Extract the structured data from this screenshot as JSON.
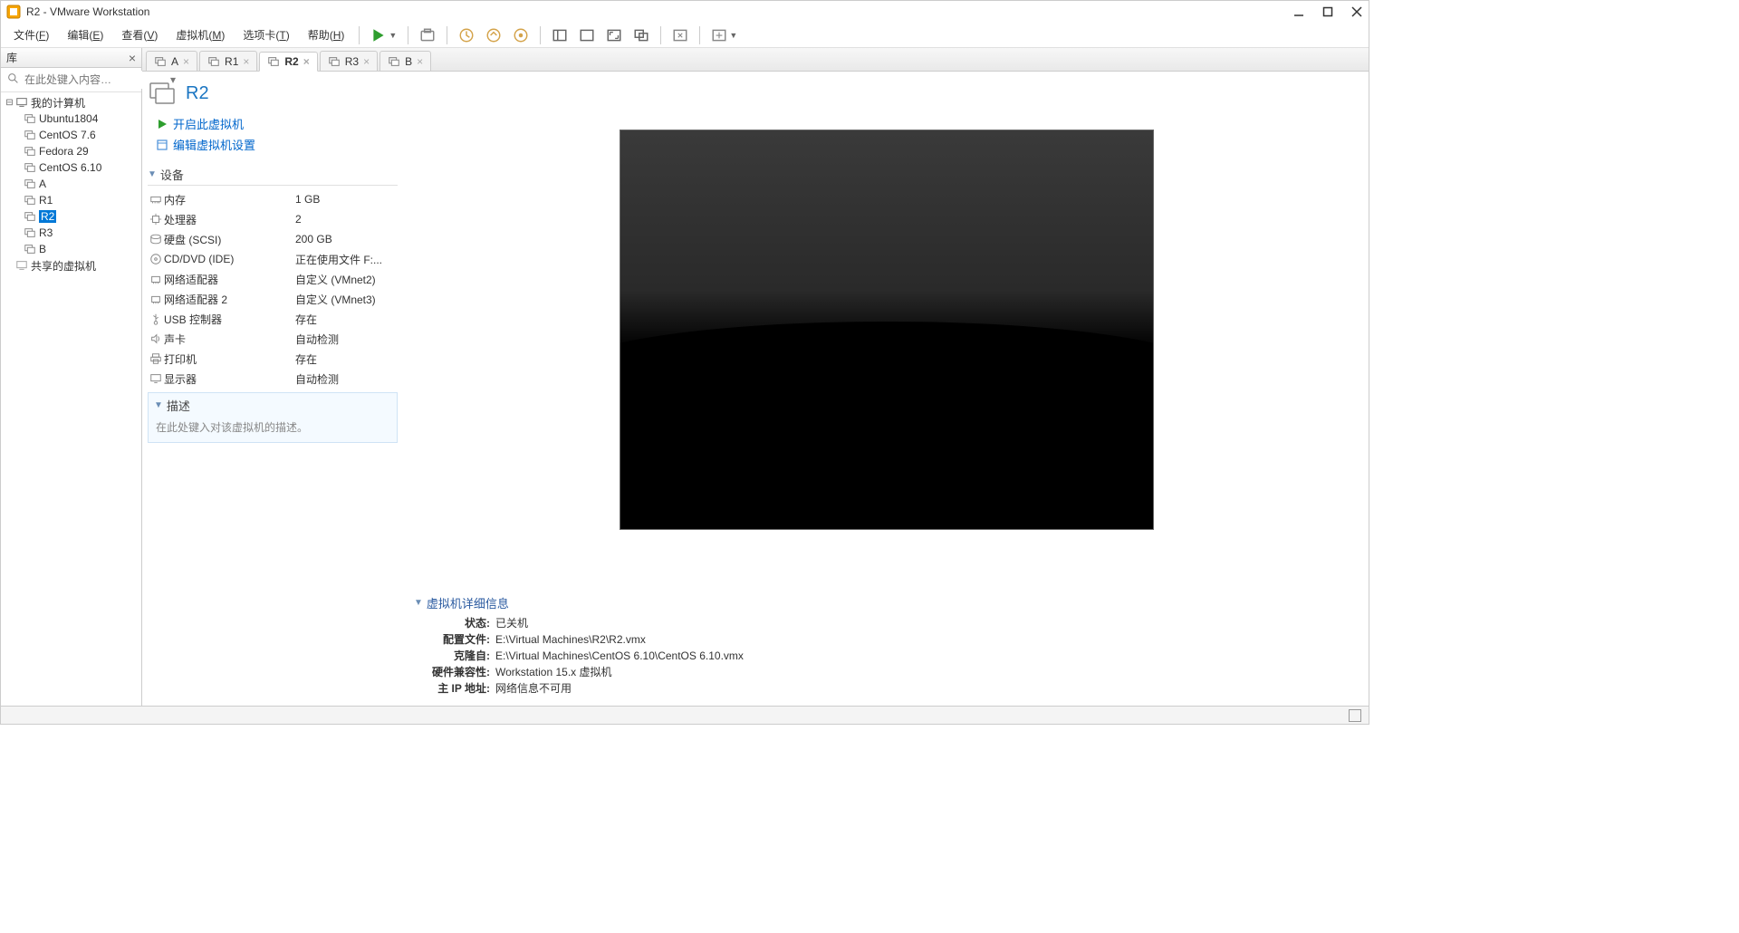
{
  "title": "R2 - VMware Workstation",
  "menus": {
    "file": "文件(F)",
    "edit": "编辑(E)",
    "view": "查看(V)",
    "vm": "虚拟机(M)",
    "tabs": "选项卡(T)",
    "help": "帮助(H)"
  },
  "sidebar": {
    "header": "库",
    "search_placeholder": "在此处键入内容…",
    "root": "我的计算机",
    "items": [
      {
        "label": "Ubuntu1804",
        "icon": "vm"
      },
      {
        "label": "CentOS 7.6",
        "icon": "vm"
      },
      {
        "label": "Fedora 29",
        "icon": "vm"
      },
      {
        "label": "CentOS 6.10",
        "icon": "vm"
      },
      {
        "label": "A",
        "icon": "vm"
      },
      {
        "label": "R1",
        "icon": "vm"
      },
      {
        "label": "R2",
        "icon": "vm",
        "selected": true
      },
      {
        "label": "R3",
        "icon": "vm"
      },
      {
        "label": "B",
        "icon": "vm"
      }
    ],
    "shared": "共享的虚拟机"
  },
  "tabs": [
    {
      "label": "A"
    },
    {
      "label": "R1"
    },
    {
      "label": "R2",
      "active": true
    },
    {
      "label": "R3"
    },
    {
      "label": "B"
    }
  ],
  "vm": {
    "name": "R2",
    "actions": {
      "power_on": "开启此虚拟机",
      "edit_settings": "编辑虚拟机设置"
    },
    "devices_header": "设备",
    "devices": [
      {
        "icon": "memory-icon",
        "name": "内存",
        "value": "1 GB"
      },
      {
        "icon": "cpu-icon",
        "name": "处理器",
        "value": "2"
      },
      {
        "icon": "disk-icon",
        "name": "硬盘 (SCSI)",
        "value": "200 GB"
      },
      {
        "icon": "cd-icon",
        "name": "CD/DVD (IDE)",
        "value": "正在使用文件 F:..."
      },
      {
        "icon": "nic-icon",
        "name": "网络适配器",
        "value": "自定义 (VMnet2)"
      },
      {
        "icon": "nic-icon",
        "name": "网络适配器 2",
        "value": "自定义 (VMnet3)"
      },
      {
        "icon": "usb-icon",
        "name": "USB 控制器",
        "value": "存在"
      },
      {
        "icon": "sound-icon",
        "name": "声卡",
        "value": "自动检测"
      },
      {
        "icon": "printer-icon",
        "name": "打印机",
        "value": "存在"
      },
      {
        "icon": "display-icon",
        "name": "显示器",
        "value": "自动检测"
      }
    ],
    "description_header": "描述",
    "description_placeholder": "在此处键入对该虚拟机的描述。"
  },
  "details": {
    "header": "虚拟机详细信息",
    "rows": [
      {
        "k": "状态:",
        "v": "已关机"
      },
      {
        "k": "配置文件:",
        "v": "E:\\Virtual Machines\\R2\\R2.vmx"
      },
      {
        "k": "克隆自:",
        "v": "E:\\Virtual Machines\\CentOS 6.10\\CentOS 6.10.vmx"
      },
      {
        "k": "硬件兼容性:",
        "v": "Workstation 15.x 虚拟机"
      },
      {
        "k": "主 IP 地址:",
        "v": "网络信息不可用"
      }
    ]
  }
}
